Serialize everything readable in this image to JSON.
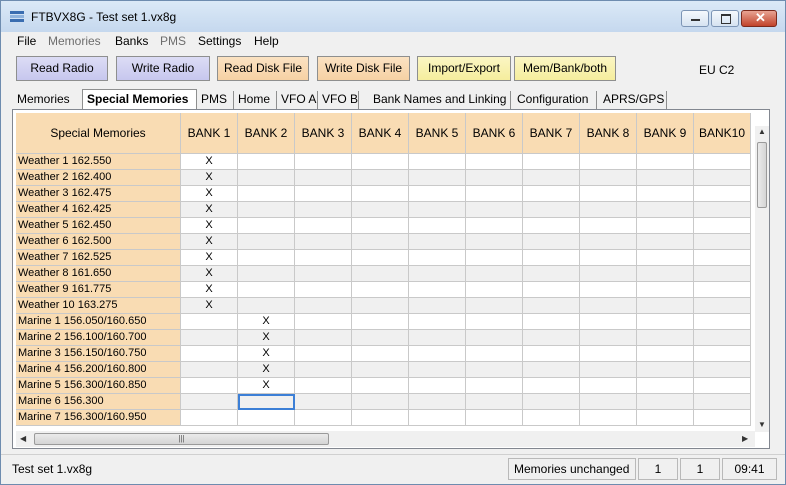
{
  "window": {
    "title": "FTBVX8G - Test set 1.vx8g"
  },
  "menu": [
    "File",
    "Memories",
    "Banks",
    "PMS",
    "Settings",
    "Help"
  ],
  "toolbar": {
    "buttons": [
      "Read Radio",
      "Write Radio",
      "Read Disk File",
      "Write Disk File",
      "Import/Export",
      "Mem/Bank/both"
    ],
    "region": "EU C2"
  },
  "tabs": [
    "Memories",
    "Special Memories",
    "PMS",
    "Home",
    "VFO A",
    "VFO B",
    "Bank Names and Linking",
    "Configuration",
    "APRS/GPS"
  ],
  "grid": {
    "corner_header": "Special Memories",
    "columns": [
      "BANK 1",
      "BANK 2",
      "BANK 3",
      "BANK 4",
      "BANK 5",
      "BANK 6",
      "BANK 7",
      "BANK 8",
      "BANK 9",
      "BANK10"
    ],
    "rows": [
      {
        "name": "Weather 1 162.550",
        "marks": [
          "X",
          "",
          "",
          "",
          "",
          "",
          "",
          "",
          "",
          ""
        ]
      },
      {
        "name": "Weather 2 162.400",
        "marks": [
          "X",
          "",
          "",
          "",
          "",
          "",
          "",
          "",
          "",
          ""
        ]
      },
      {
        "name": "Weather 3 162.475",
        "marks": [
          "X",
          "",
          "",
          "",
          "",
          "",
          "",
          "",
          "",
          ""
        ]
      },
      {
        "name": "Weather 4 162.425",
        "marks": [
          "X",
          "",
          "",
          "",
          "",
          "",
          "",
          "",
          "",
          ""
        ]
      },
      {
        "name": "Weather 5 162.450",
        "marks": [
          "X",
          "",
          "",
          "",
          "",
          "",
          "",
          "",
          "",
          ""
        ]
      },
      {
        "name": "Weather 6 162.500",
        "marks": [
          "X",
          "",
          "",
          "",
          "",
          "",
          "",
          "",
          "",
          ""
        ]
      },
      {
        "name": "Weather 7 162.525",
        "marks": [
          "X",
          "",
          "",
          "",
          "",
          "",
          "",
          "",
          "",
          ""
        ]
      },
      {
        "name": "Weather 8 161.650",
        "marks": [
          "X",
          "",
          "",
          "",
          "",
          "",
          "",
          "",
          "",
          ""
        ]
      },
      {
        "name": "Weather 9 161.775",
        "marks": [
          "X",
          "",
          "",
          "",
          "",
          "",
          "",
          "",
          "",
          ""
        ]
      },
      {
        "name": "Weather 10 163.275",
        "marks": [
          "X",
          "",
          "",
          "",
          "",
          "",
          "",
          "",
          "",
          ""
        ]
      },
      {
        "name": "Marine 1 156.050/160.650",
        "marks": [
          "",
          "X",
          "",
          "",
          "",
          "",
          "",
          "",
          "",
          ""
        ]
      },
      {
        "name": "Marine 2 156.100/160.700",
        "marks": [
          "",
          "X",
          "",
          "",
          "",
          "",
          "",
          "",
          "",
          ""
        ]
      },
      {
        "name": "Marine 3 156.150/160.750",
        "marks": [
          "",
          "X",
          "",
          "",
          "",
          "",
          "",
          "",
          "",
          ""
        ]
      },
      {
        "name": "Marine 4 156.200/160.800",
        "marks": [
          "",
          "X",
          "",
          "",
          "",
          "",
          "",
          "",
          "",
          ""
        ]
      },
      {
        "name": "Marine 5 156.300/160.850",
        "marks": [
          "",
          "X",
          "",
          "",
          "",
          "",
          "",
          "",
          "",
          ""
        ]
      },
      {
        "name": "Marine 6 156.300",
        "marks": [
          "",
          "",
          "",
          "",
          "",
          "",
          "",
          "",
          "",
          ""
        ]
      },
      {
        "name": "Marine 7 156.300/160.950",
        "marks": [
          "",
          "",
          "",
          "",
          "",
          "",
          "",
          "",
          "",
          ""
        ]
      }
    ]
  },
  "status": {
    "file": "Test set 1.vx8g",
    "state": "Memories unchanged",
    "v1": "1",
    "v2": "1",
    "time": "09:41"
  }
}
